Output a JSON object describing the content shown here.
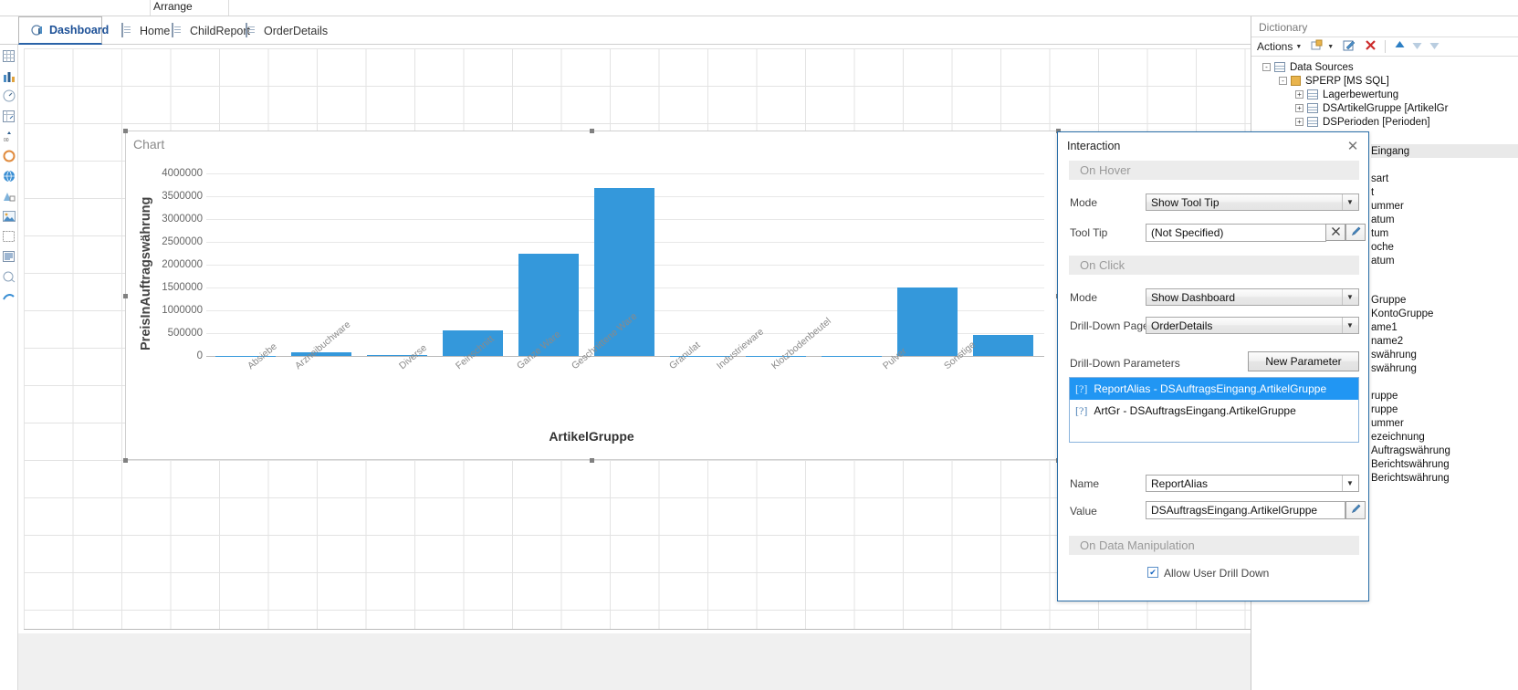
{
  "ribbon": {
    "arrange_label": "Arrange"
  },
  "tabs": [
    {
      "label": "Dashboard",
      "icon": "dashboard-icon",
      "active": true
    },
    {
      "label": "Home",
      "icon": "page-icon",
      "active": false
    },
    {
      "label": "ChildReport",
      "icon": "page-icon",
      "active": false
    },
    {
      "label": "OrderDetails",
      "icon": "page-icon",
      "active": false
    }
  ],
  "toolbox": [
    "table-icon",
    "bar-chart-icon",
    "gauge-icon",
    "cross-tab-icon",
    "map-icon",
    "pie-icon",
    "globe-icon",
    "shape-icon",
    "image-icon",
    "panel-icon",
    "richtext-icon",
    "zone-icon",
    "arrow-icon"
  ],
  "chart": {
    "component_title": "Chart"
  },
  "chart_data": {
    "type": "bar",
    "title": "Chart",
    "xlabel": "ArtikelGruppe",
    "ylabel": "PreisInAuftragswährung",
    "ylim": [
      0,
      4000000
    ],
    "yticks": [
      4000000,
      3500000,
      3000000,
      2500000,
      2000000,
      1500000,
      1000000,
      500000,
      0
    ],
    "ytick_labels": [
      "4000000",
      "3500000",
      "3000000",
      "2500000",
      "2000000",
      "1500000",
      "1000000",
      "500000",
      "0"
    ],
    "grid": true,
    "legend": "none",
    "series_color": "#3498db",
    "categories": [
      "Absiebe",
      "Arzneibuchware",
      "Diverse",
      "Feinschnitt",
      "Ganze Ware",
      "Geschnittene Ware",
      "Granulat",
      "Industrieware",
      "Klotzbodenbeutel",
      "Pulver",
      "Sonstige"
    ],
    "values": [
      0,
      70000,
      20000,
      560000,
      2230000,
      3680000,
      0,
      0,
      0,
      1500000,
      460000
    ]
  },
  "interaction": {
    "title": "Interaction",
    "close_icon": "close-icon",
    "sections": {
      "on_hover": "On Hover",
      "on_click": "On Click",
      "on_data_manipulation": "On Data Manipulation"
    },
    "hover_mode_label": "Mode",
    "hover_mode_value": "Show Tool Tip",
    "tooltip_label": "Tool Tip",
    "tooltip_value": "(Not Specified)",
    "tooltip_clear_icon": "clear-icon",
    "tooltip_edit_icon": "edit-pencil-icon",
    "click_mode_label": "Mode",
    "click_mode_value": "Show Dashboard",
    "drilldown_page_label": "Drill-Down Page",
    "drilldown_page_value": "OrderDetails",
    "drilldown_params_label": "Drill-Down Parameters",
    "new_parameter_button": "New Parameter",
    "parameters": [
      {
        "text": "ReportAlias - DSAuftragsEingang.ArtikelGruppe",
        "selected": true
      },
      {
        "text": "ArtGr - DSAuftragsEingang.ArtikelGruppe",
        "selected": false
      }
    ],
    "name_label": "Name",
    "name_value": "ReportAlias",
    "value_label": "Value",
    "value_value": "DSAuftragsEingang.ArtikelGruppe",
    "value_edit_icon": "edit-pencil-icon",
    "allow_drilldown_label": "Allow User Drill Down",
    "allow_drilldown_checked": true
  },
  "dictionary": {
    "title": "Dictionary",
    "toolbar": {
      "actions_label": "Actions",
      "icons": [
        "new-item-icon",
        "edit-icon",
        "delete-icon",
        "move-up-icon",
        "move-down-icon"
      ]
    },
    "tree": [
      {
        "indent": 0,
        "label": "Data Sources",
        "icon": "table-icon",
        "expander": "-"
      },
      {
        "indent": 1,
        "label": "SPERP [MS SQL]",
        "icon": "database-icon",
        "expander": "-"
      },
      {
        "indent": 2,
        "label": "Lagerbewertung",
        "icon": "table-icon",
        "expander": "+"
      },
      {
        "indent": 2,
        "label": "DSArtikelGruppe [ArtikelGr",
        "icon": "table-icon",
        "expander": "+"
      },
      {
        "indent": 2,
        "label": "DSPerioden [Perioden]",
        "icon": "table-icon",
        "expander": "+"
      }
    ],
    "fields": [
      "Eingang",
      "sart",
      "t",
      "ummer",
      "atum",
      "tum",
      "oche",
      "atum",
      "Gruppe",
      "KontoGruppe",
      "ame1",
      "name2",
      "swährung",
      "swährung",
      "ruppe",
      "ruppe",
      "ummer",
      "ezeichnung",
      "Auftragswährung",
      "Berichtswährung",
      "Berichtswährung"
    ]
  }
}
